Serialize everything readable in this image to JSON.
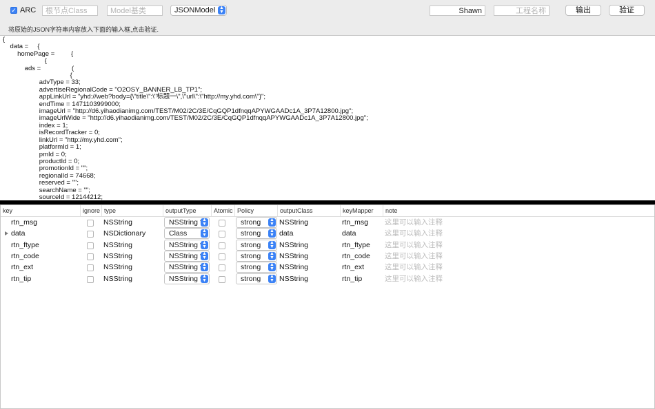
{
  "toolbar": {
    "arc_label": "ARC",
    "root_class_placeholder": "根节点Class",
    "model_base_placeholder": "Model基类",
    "framework_value": "JSONModel",
    "author_value": "Shawn",
    "project_placeholder": "工程名称",
    "output_label": "输出",
    "verify_label": "验证"
  },
  "hint": "将原始的JSON字符串内容放入下面的输入框,点击验证.",
  "json_text": "{\n    data =     {\n        homePage =         {\n                       {\n            ads =                 (\n                                     {\n                    advType = 33;\n                    advertiseRegionalCode = \"O2OSY_BANNER_LB_TP1\";\n                    appLinkUrl = \"yhd://web?body={\\\"title\\\":\\\"标题一\\\",\\\"url\\\":\\\"http://my.yhd.com\\\"}\";\n                    endTime = 1471103999000;\n                    imageUrl = \"http://d6.yihaodianimg.com/TEST/M02/2C/3E/CqGQP1dfnqqAPYWGAADc1A_3P7A12800.jpg\";\n                    imageUrlWide = \"http://d6.yihaodianimg.com/TEST/M02/2C/3E/CqGQP1dfnqqAPYWGAADc1A_3P7A12800.jpg\";\n                    index = 1;\n                    isRecordTracker = 0;\n                    linkUrl = \"http://my.yhd.com\";\n                    platformId = 1;\n                    pmId = 0;\n                    productId = 0;\n                    promotionId = \"\";\n                    regionalId = 74668;\n                    reserved = \"\";\n                    searchName = \"\";\n                    sourceId = 12144212;",
  "table": {
    "headers": [
      "key",
      "ignore",
      "type",
      "outputType",
      "Atomic",
      "Policy",
      "outputClass",
      "keyMapper",
      "note"
    ],
    "rows": [
      {
        "key": "rtn_msg",
        "type": "NSString",
        "outputType": "NSString *",
        "policy": "strong",
        "outputClass": "NSString",
        "keyMapper": "rtn_msg",
        "note": "这里可以输入注释"
      },
      {
        "key": "data",
        "type": "NSDictionary",
        "outputType": "Class",
        "policy": "strong",
        "outputClass": "data",
        "keyMapper": "data",
        "note": "这里可以输入注释"
      },
      {
        "key": "rtn_ftype",
        "type": "NSString",
        "outputType": "NSString *",
        "policy": "strong",
        "outputClass": "NSString",
        "keyMapper": "rtn_ftype",
        "note": "这里可以输入注释"
      },
      {
        "key": "rtn_code",
        "type": "NSString",
        "outputType": "NSString *",
        "policy": "strong",
        "outputClass": "NSString",
        "keyMapper": "rtn_code",
        "note": "这里可以输入注释"
      },
      {
        "key": "rtn_ext",
        "type": "NSString",
        "outputType": "NSString *",
        "policy": "strong",
        "outputClass": "NSString",
        "keyMapper": "rtn_ext",
        "note": "这里可以输入注释"
      },
      {
        "key": "rtn_tip",
        "type": "NSString",
        "outputType": "NSString *",
        "policy": "strong",
        "outputClass": "NSString",
        "keyMapper": "rtn_tip",
        "note": "这里可以输入注释"
      }
    ]
  },
  "colors": {
    "accent": "#3b82f6",
    "divider": "#000000",
    "placeholder": "#b4b4b4"
  }
}
